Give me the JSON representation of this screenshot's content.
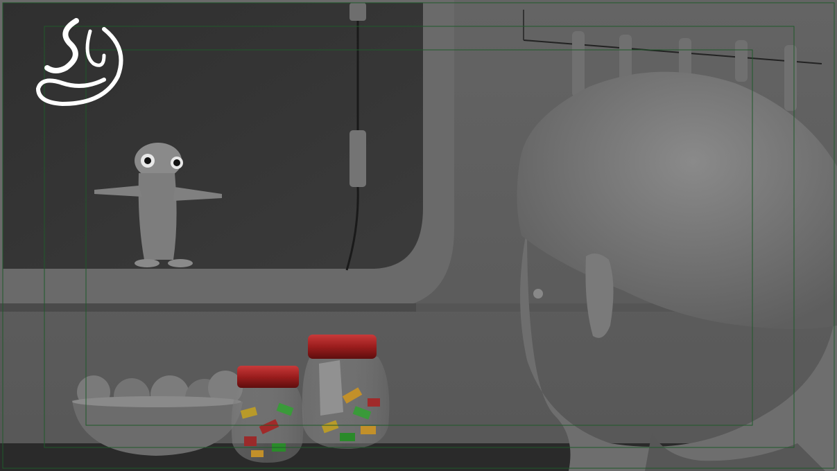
{
  "viewport": {
    "logo_icon": "sy-swirl-logo-icon",
    "render_mode": "smooth-shade-gray",
    "guides": [
      "safe-action-guide",
      "safe-title-guide",
      "resolution-gate-guide"
    ]
  },
  "colors": {
    "background": "#5c5c5c",
    "wall": "#626262",
    "shelf_shadow": "#3c3c3c",
    "guide_green": "#1f5a2a",
    "jar_lid": "#9b1d1d",
    "logo": "#ffffff"
  },
  "scene": {
    "objects": [
      "chameleon-figure",
      "hanging-lamp-cord",
      "utensil-rack",
      "fruit-bowl",
      "candy-jar-small",
      "candy-jar-large",
      "character-head"
    ]
  }
}
